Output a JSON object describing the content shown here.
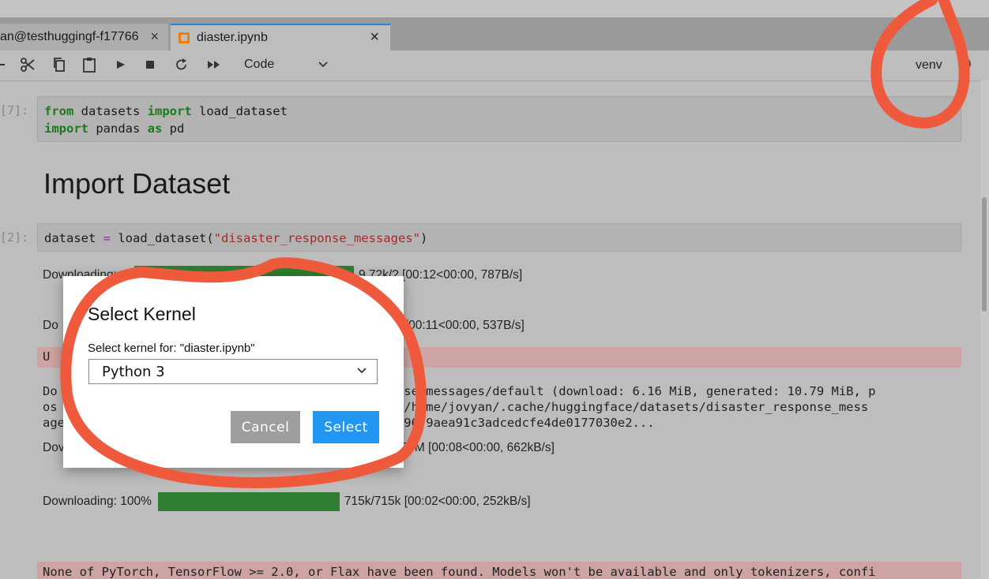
{
  "tabs": [
    {
      "label": "an@testhuggingf-f17766",
      "close": "×"
    },
    {
      "label": "diaster.ipynb",
      "close": "×"
    }
  ],
  "toolbar": {
    "cell_type": "Code",
    "kernel_name": "venv"
  },
  "cells": {
    "c1": {
      "prompt": "[7]:",
      "line1": {
        "kw1": "from",
        "t1": " datasets ",
        "kw2": "import",
        "t2": " load_dataset"
      },
      "line2": {
        "kw1": "import",
        "t1": " pandas ",
        "kw2": "as",
        "t2": " pd"
      }
    },
    "heading": "Import Dataset",
    "c2": {
      "prompt": "[2]:",
      "code": {
        "a": "dataset ",
        "op": "=",
        "b": " load_dataset(",
        "str": "\"disaster_response_messages\"",
        "c": ")"
      }
    }
  },
  "outputs": {
    "p1": {
      "label": "Downloading:",
      "info": "9.72k/? [00:12<00:00, 787B/s]",
      "progress": 1.0
    },
    "p2": {
      "label": "Do",
      "info": "[00:11<00:00, 537B/s]"
    },
    "warn_prefix": "U",
    "log_line1": "Do                                          es onse_messages/default (download: 6.16 MiB, generated: 10.79 MiB, p",
    "log_line2": "os                                         3) to /home/jovyan/.cache/huggingface/datasets/disaster_response_mess",
    "log_line3": "age                                         c831396f9aea91c3adcedcfe4de0177030e2...",
    "p3": {
      "label": "Dov",
      "info": "75M [00:08<00:00, 662kB/s]"
    },
    "p4": {
      "label": "Downloading: 100%",
      "info": "715k/715k [00:02<00:00, 252kB/s]",
      "progress": 1.0
    },
    "warning": "None of PyTorch, TensorFlow >= 2.0, or Flax have been found. Models won't be available and only tokenizers, confi"
  },
  "dialog": {
    "title": "Select Kernel",
    "label": "Select kernel for: \"diaster.ipynb\"",
    "selected": "Python 3",
    "cancel": "Cancel",
    "select": "Select"
  },
  "colors": {
    "accent": "#2196f3",
    "progress": "#2e7d32",
    "annotation": "#f05a3c",
    "stderr_bg": "#cda3a3"
  }
}
